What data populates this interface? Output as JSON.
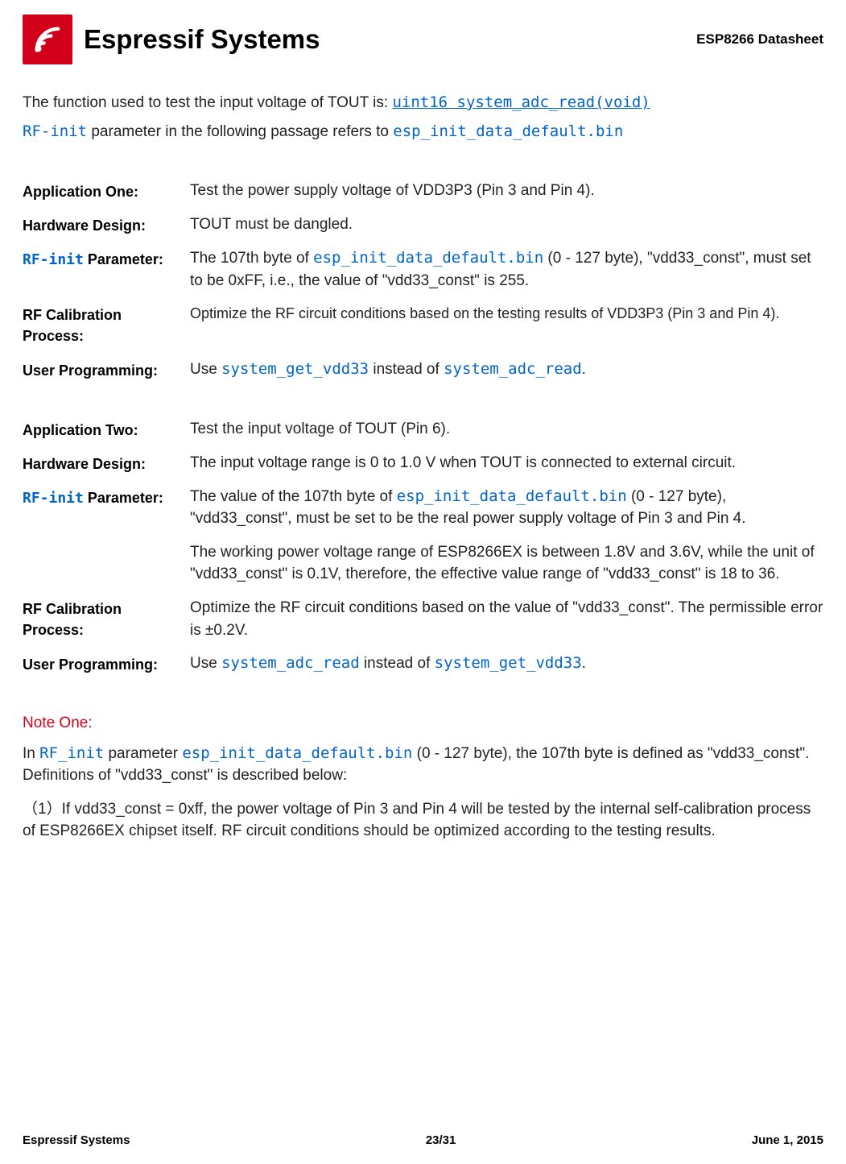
{
  "header": {
    "brand": "Espressif Systems",
    "doc_title": "ESP8266  Datasheet"
  },
  "intro": {
    "line1_pre": "The function used to test the input voltage of TOUT is: ",
    "line1_code": "uint16 system_adc_read(void)",
    "line2_code1": "RF-init",
    "line2_mid": " parameter in the following passage refers to ",
    "line2_code2": "esp_init_data_default.bin"
  },
  "app1": {
    "r1_label": "Application One:",
    "r1_value": "Test the power supply voltage of VDD3P3 (Pin 3 and Pin 4).",
    "r2_label": "Hardware Design:",
    "r2_value": "TOUT must be dangled.",
    "r3_label_code": "RF-init",
    "r3_label_rest": " Parameter:",
    "r3_value_pre": "The 107th byte of ",
    "r3_value_code": "esp_init_data_default.bin",
    "r3_value_post": "  (0 - 127 byte), \"vdd33_const\", must set to be 0xFF, i.e., the value of \"vdd33_const\" is 255.",
    "r4_label": "RF Calibration Process:",
    "r4_value": "Optimize the RF circuit conditions based on the testing results of VDD3P3 (Pin 3 and Pin 4).",
    "r5_label": "User Programming:",
    "r5_pre": "Use ",
    "r5_code1": "system_get_vdd33",
    "r5_mid": " instead of ",
    "r5_code2": "system_adc_read",
    "r5_post": "."
  },
  "app2": {
    "r1_label": "Application Two:",
    "r1_value": "Test the input voltage of TOUT (Pin 6).",
    "r2_label": "Hardware Design:",
    "r2_value": "The input voltage range is 0 to 1.0 V when TOUT is connected to external circuit.",
    "r3_label_code": "RF-init",
    "r3_label_rest": " Parameter:",
    "r3_p1_pre": "The value of the 107th byte of ",
    "r3_p1_code": "esp_init_data_default.bin",
    "r3_p1_post": "  (0 - 127 byte), \"vdd33_const\", must be set to be the real power supply voltage of Pin 3 and Pin 4.",
    "r3_p2": "The working power voltage range of ESP8266EX is between 1.8V and 3.6V, while the unit of \"vdd33_const\" is 0.1V, therefore, the effective value range of \"vdd33_const\" is 18 to 36.",
    "r4_label": "RF Calibration Process:",
    "r4_value": "Optimize the RF circuit conditions based on the value of \"vdd33_const\". The permissible error is ±0.2V.",
    "r5_label": "User Programming:",
    "r5_pre": "Use ",
    "r5_code1": "system_adc_read",
    "r5_mid": " instead of ",
    "r5_code2": "system_get_vdd33",
    "r5_post": "."
  },
  "note": {
    "heading": "Note One:",
    "p1_pre": "In ",
    "p1_code1": "RF_init",
    "p1_mid": " parameter ",
    "p1_code2": "esp_init_data_default.bin",
    "p1_post": "  (0 - 127 byte), the 107th byte is defined as \"vdd33_const\". Definitions of \"vdd33_const\" is described below:",
    "p2": "（1）If  vdd33_const = 0xff, the power voltage of Pin 3 and Pin 4 will be tested by the internal self-calibration process of ESP8266EX chipset itself.  RF circuit conditions should be optimized according to the testing results."
  },
  "footer": {
    "left": "Espressif Systems",
    "center": "23/31",
    "right": "June 1, 2015"
  }
}
